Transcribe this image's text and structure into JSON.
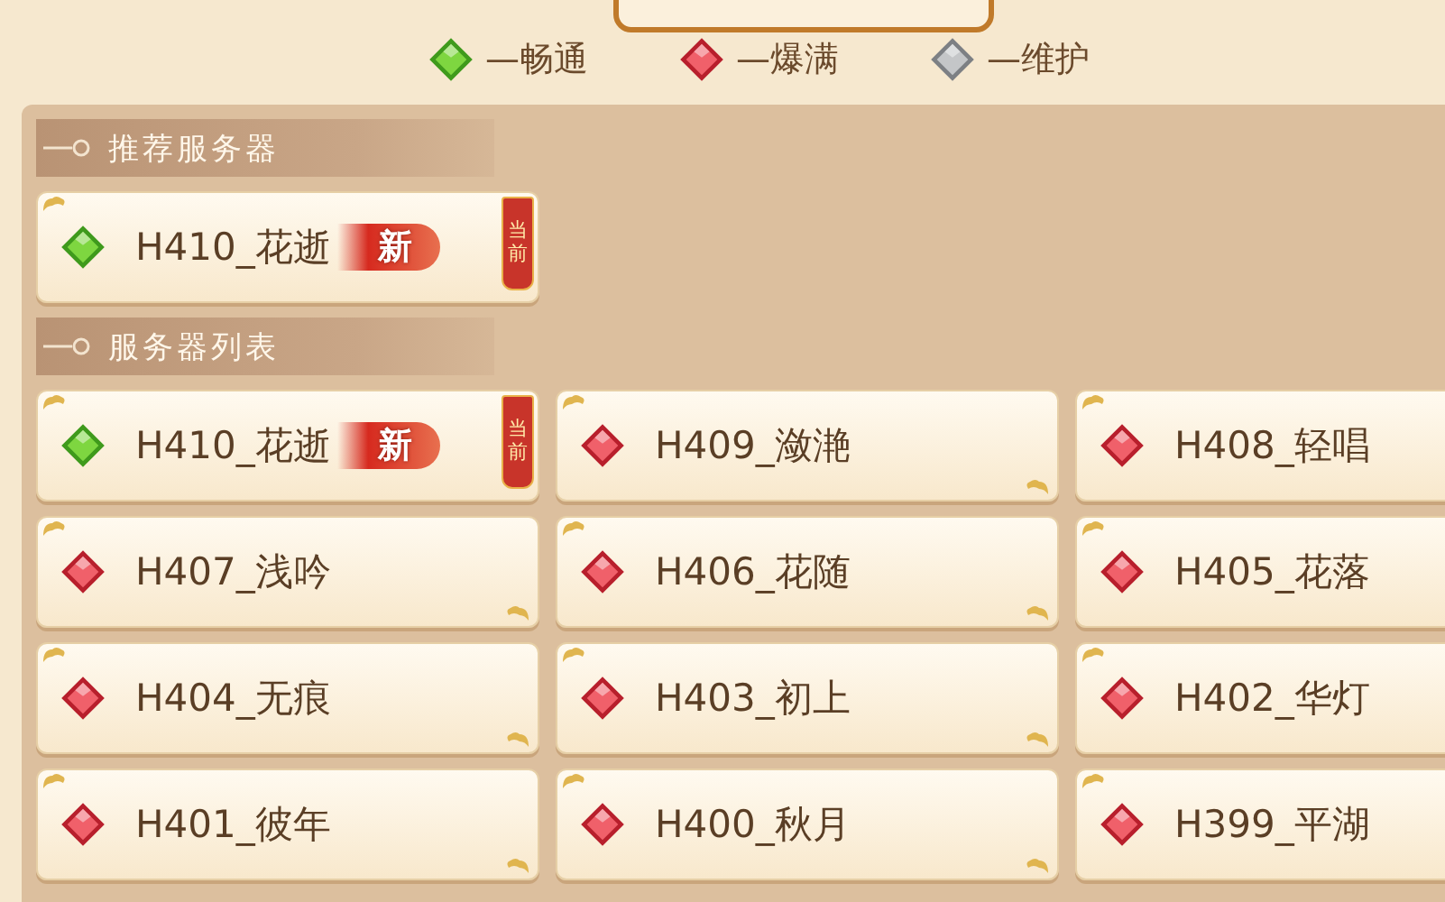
{
  "legend": [
    {
      "kind": "smooth",
      "label": "—畅通"
    },
    {
      "kind": "full",
      "label": "—爆满"
    },
    {
      "kind": "maintenance",
      "label": "—维护"
    }
  ],
  "recommended": {
    "title": "推荐服务器",
    "servers": [
      {
        "name": "H410_花逝",
        "kind": "smooth",
        "new_badge": "新",
        "current_badge": "当前"
      }
    ]
  },
  "server_list": {
    "title": "服务器列表",
    "servers": [
      {
        "name": "H410_花逝",
        "kind": "smooth",
        "new_badge": "新",
        "current_badge": "当前"
      },
      {
        "name": "H409_潋滟",
        "kind": "full"
      },
      {
        "name": "H408_轻唱",
        "kind": "full"
      },
      {
        "name": "H407_浅吟",
        "kind": "full"
      },
      {
        "name": "H406_花随",
        "kind": "full"
      },
      {
        "name": "H405_花落",
        "kind": "full"
      },
      {
        "name": "H404_无痕",
        "kind": "full"
      },
      {
        "name": "H403_初上",
        "kind": "full"
      },
      {
        "name": "H402_华灯",
        "kind": "full"
      },
      {
        "name": "H401_彼年",
        "kind": "full"
      },
      {
        "name": "H400_秋月",
        "kind": "full"
      },
      {
        "name": "H399_平湖",
        "kind": "full"
      }
    ]
  }
}
